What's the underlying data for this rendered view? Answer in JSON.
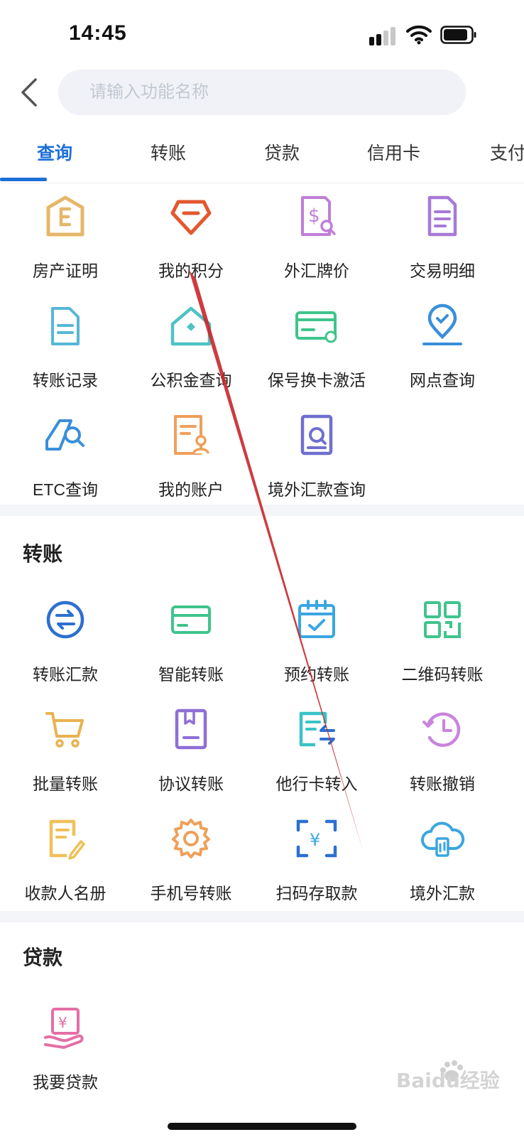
{
  "status_bar": {
    "time": "14:45"
  },
  "search": {
    "placeholder": "请输入功能名称"
  },
  "tabs": [
    {
      "label": "查询"
    },
    {
      "label": "转账"
    },
    {
      "label": "贷款"
    },
    {
      "label": "信用卡"
    },
    {
      "label": "支付"
    }
  ],
  "query_section": {
    "items": [
      {
        "label": "房产证明",
        "icon": "house-certificate-icon",
        "color": "#e6b769"
      },
      {
        "label": "我的积分",
        "icon": "points-diamond-icon",
        "color": "#e2582f"
      },
      {
        "label": "外汇牌价",
        "icon": "forex-rate-icon",
        "color": "#c07ed8"
      },
      {
        "label": "交易明细",
        "icon": "transaction-detail-icon",
        "color": "#a77ad8"
      },
      {
        "label": "转账记录",
        "icon": "transfer-record-icon",
        "color": "#56b7d8"
      },
      {
        "label": "公积金查询",
        "icon": "housing-fund-icon",
        "color": "#4ec3c6"
      },
      {
        "label": "保号换卡激活",
        "icon": "card-activate-icon",
        "color": "#3fc48c"
      },
      {
        "label": "网点查询",
        "icon": "branch-location-icon",
        "color": "#3a8fd9"
      },
      {
        "label": "ETC查询",
        "icon": "etc-query-icon",
        "color": "#3a8fd9"
      },
      {
        "label": "我的账户",
        "icon": "my-account-icon",
        "color": "#eea05a"
      },
      {
        "label": "境外汇款查询",
        "icon": "overseas-remit-query-icon",
        "color": "#6f6fcf"
      }
    ]
  },
  "transfer_section": {
    "title": "转账",
    "items": [
      {
        "label": "转账汇款",
        "icon": "transfer-remit-icon",
        "color": "#2c6fd1"
      },
      {
        "label": "智能转账",
        "icon": "smart-transfer-icon",
        "color": "#3fc48c"
      },
      {
        "label": "预约转账",
        "icon": "scheduled-transfer-icon",
        "color": "#3aa6e0"
      },
      {
        "label": "二维码转账",
        "icon": "qrcode-transfer-icon",
        "color": "#3fc48c"
      },
      {
        "label": "批量转账",
        "icon": "batch-cart-icon",
        "color": "#e9b24f"
      },
      {
        "label": "协议转账",
        "icon": "agreement-transfer-icon",
        "color": "#8e6fd6"
      },
      {
        "label": "他行卡转入",
        "icon": "other-bank-in-icon",
        "color": "#38c3c6"
      },
      {
        "label": "转账撤销",
        "icon": "transfer-revoke-icon",
        "color": "#c884de"
      },
      {
        "label": "收款人名册",
        "icon": "payee-list-icon",
        "color": "#efc15a"
      },
      {
        "label": "手机号转账",
        "icon": "phone-transfer-gear-icon",
        "color": "#eea05a"
      },
      {
        "label": "扫码存取款",
        "icon": "scan-deposit-icon",
        "color": "#2c6fd1"
      },
      {
        "label": "境外汇款",
        "icon": "overseas-remit-cloud-icon",
        "color": "#3aa6e0"
      }
    ]
  },
  "loan_section": {
    "title": "贷款",
    "items": [
      {
        "label": "我要贷款",
        "icon": "apply-loan-icon",
        "color": "#e46fa5"
      }
    ]
  },
  "watermark": {
    "text": "Baidu经验"
  },
  "colors": {
    "accent": "#1e6fd9",
    "annotation": "#c8262a"
  }
}
